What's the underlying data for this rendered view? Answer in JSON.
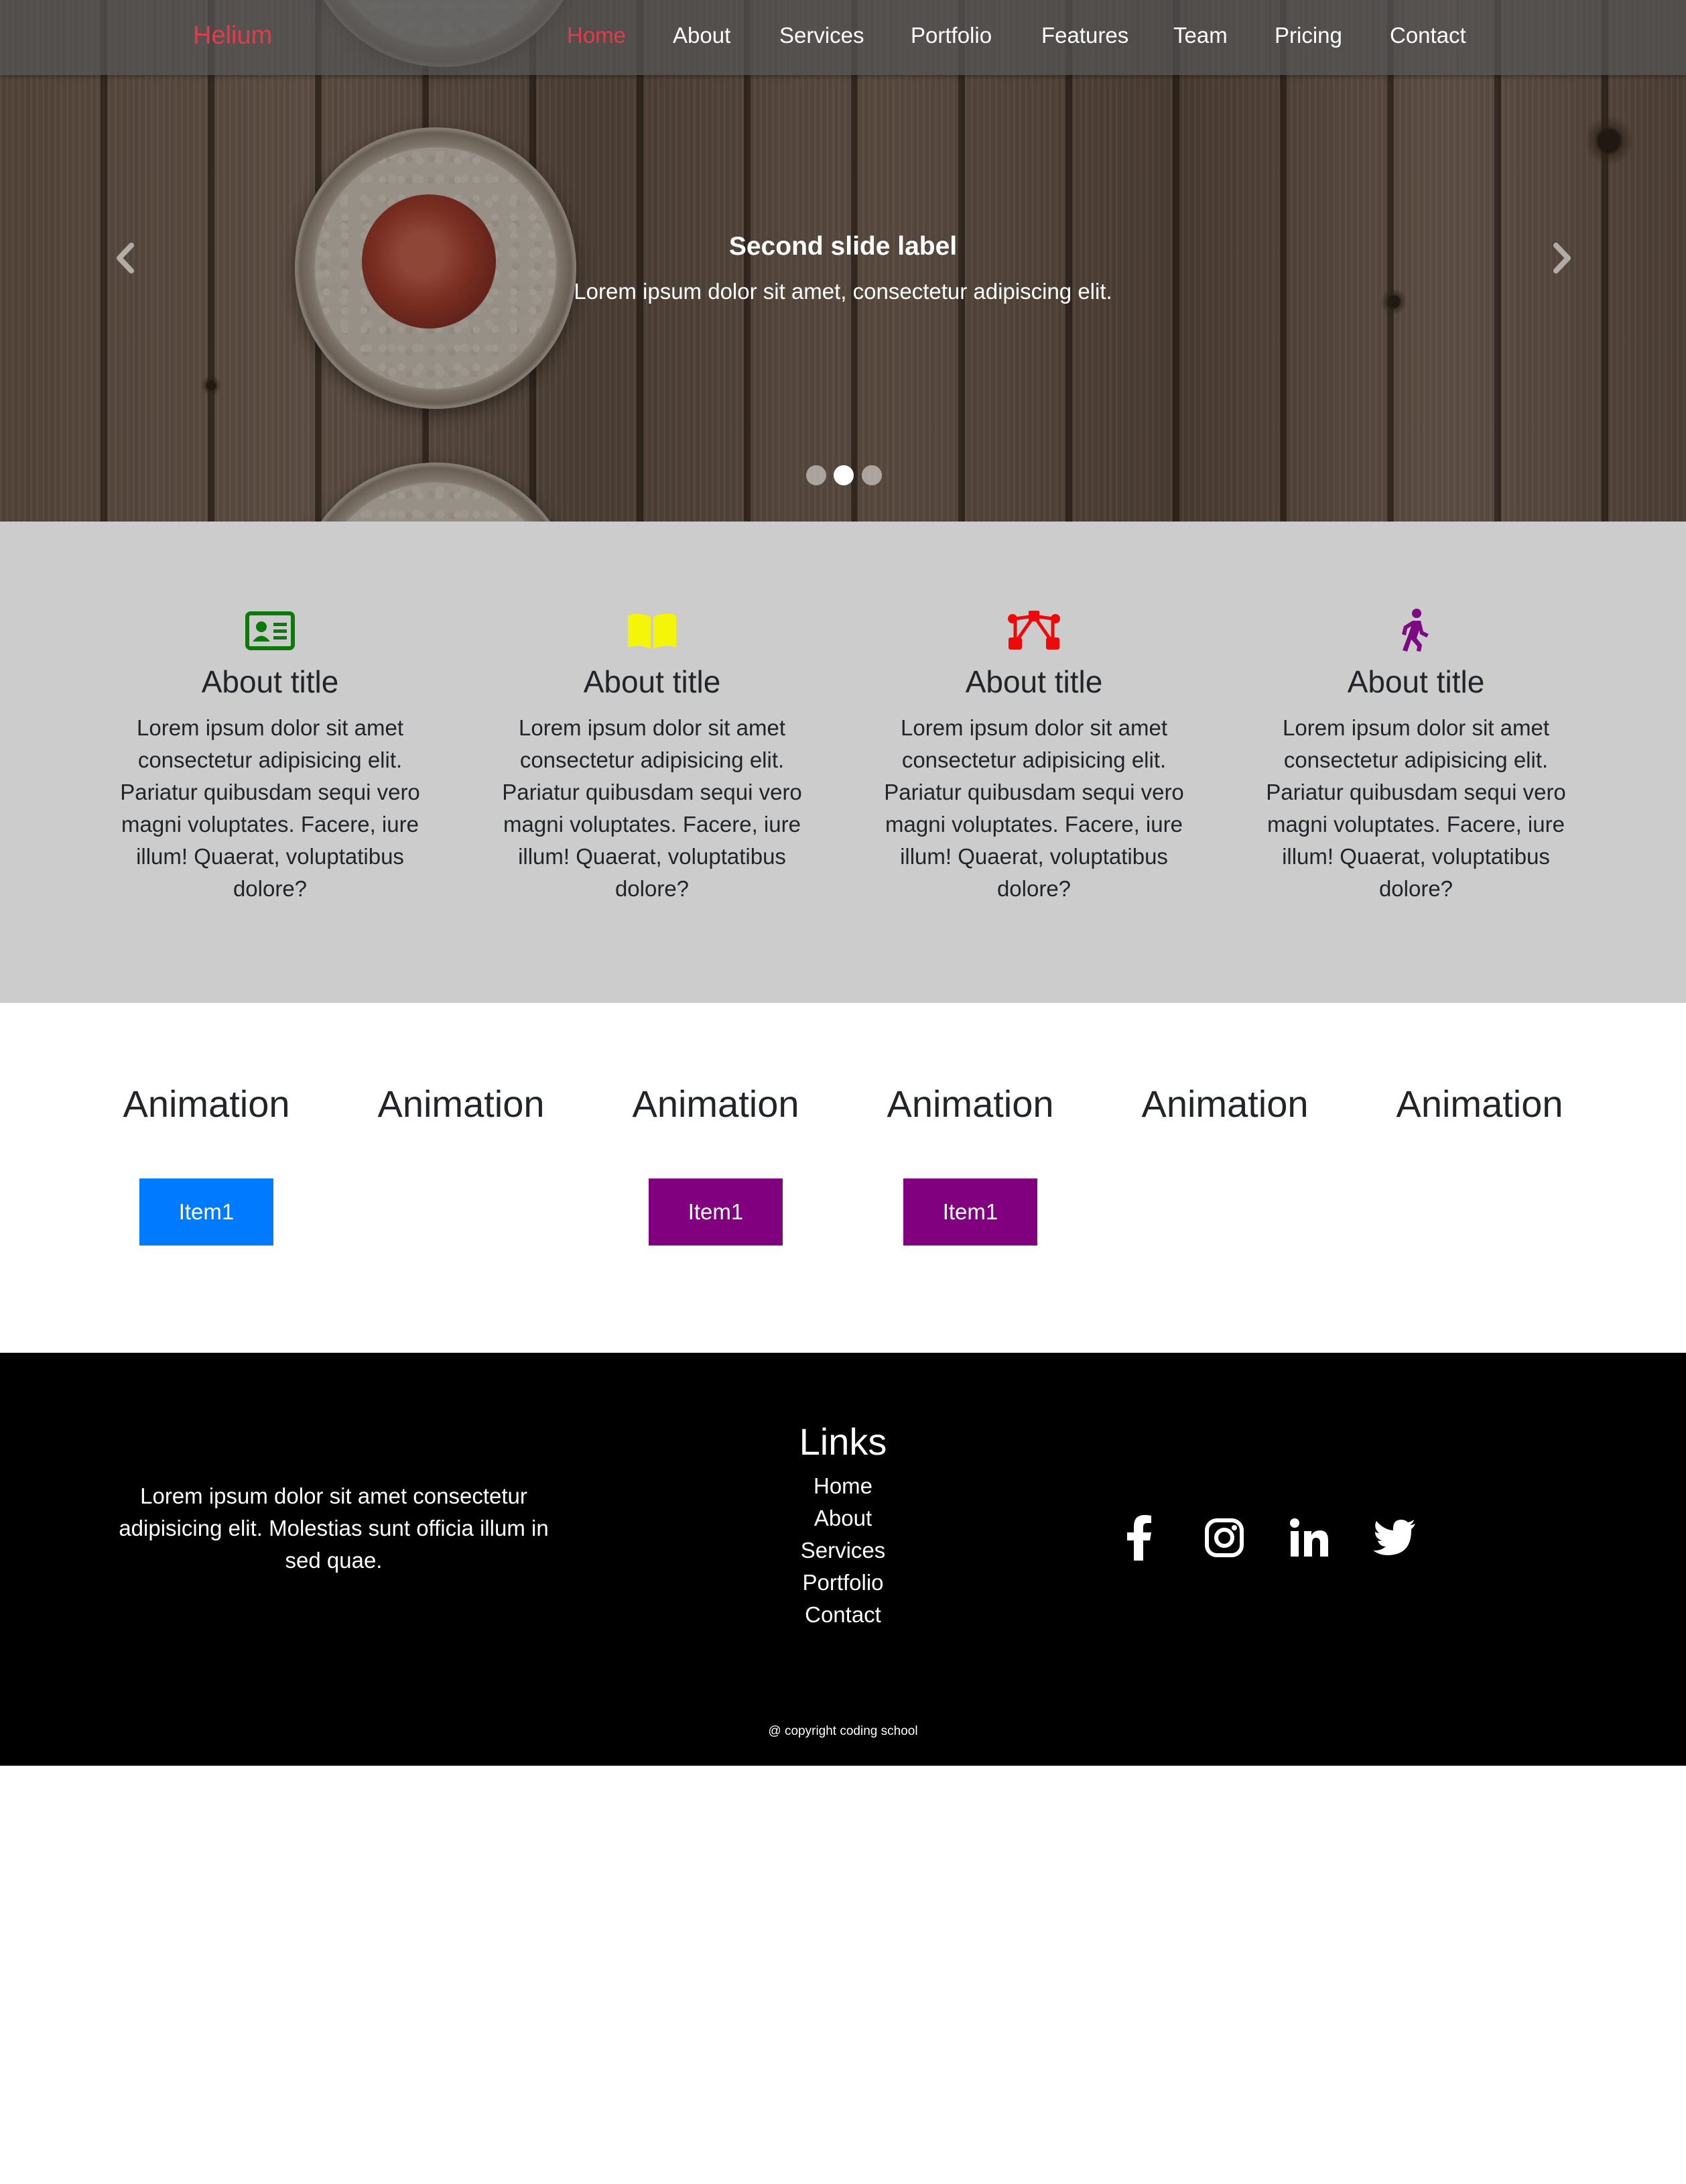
{
  "navbar": {
    "brand": "Helium",
    "items": [
      {
        "label": "Home",
        "active": true
      },
      {
        "label": "About"
      },
      {
        "label": "Services"
      },
      {
        "label": "Portfolio"
      },
      {
        "label": "Features"
      },
      {
        "label": "Team"
      },
      {
        "label": "Pricing"
      },
      {
        "label": "Contact"
      }
    ]
  },
  "carousel": {
    "caption_title": "Second slide label",
    "caption_text": "Lorem ipsum dolor sit amet, consectetur adipiscing elit.",
    "prev_icon": "chevron-left-icon",
    "next_icon": "chevron-right-icon",
    "slide_count": 3,
    "active_slide": 2
  },
  "about": {
    "cards": [
      {
        "icon": "id-card-icon",
        "icon_color": "#0b7a0b",
        "title": "About title",
        "text": "Lorem ipsum dolor sit amet consectetur adipisicing elit. Pariatur quibusdam sequi vero magni voluptates. Facere, iure illum! Quaerat, voluptatibus dolore?"
      },
      {
        "icon": "open-book-icon",
        "icon_color": "#f5f50a",
        "title": "About title",
        "text": "Lorem ipsum dolor sit amet consectetur adipisicing elit. Pariatur quibusdam sequi vero magni voluptates. Facere, iure illum! Quaerat, voluptatibus dolore?"
      },
      {
        "icon": "vector-nodes-icon",
        "icon_color": "#ee0a0a",
        "title": "About title",
        "text": "Lorem ipsum dolor sit amet consectetur adipisicing elit. Pariatur quibusdam sequi vero magni voluptates. Facere, iure illum! Quaerat, voluptatibus dolore?"
      },
      {
        "icon": "walking-person-icon",
        "icon_color": "#7c0a80",
        "title": "About title",
        "text": "Lorem ipsum dolor sit amet consectetur adipisicing elit. Pariatur quibusdam sequi vero magni voluptates. Facere, iure illum! Quaerat, voluptatibus dolore?"
      }
    ]
  },
  "animation": {
    "columns": [
      {
        "title": "Animation",
        "button": "Item1",
        "button_color": "#007bff"
      },
      {
        "title": "Animation"
      },
      {
        "title": "Animation",
        "button": "Item1",
        "button_color": "#800080"
      },
      {
        "title": "Animation",
        "button": "Item1",
        "button_color": "#800080"
      },
      {
        "title": "Animation"
      },
      {
        "title": "Animation"
      }
    ]
  },
  "footer": {
    "text": "Lorem ipsum dolor sit amet consectetur adipisicing elit. Molestias sunt officia illum in sed quae.",
    "links_title": "Links",
    "links": [
      "Home",
      "About",
      "Services",
      "Portfolio",
      "Contact"
    ],
    "social": [
      "facebook-icon",
      "instagram-icon",
      "linkedin-icon",
      "twitter-icon"
    ],
    "copyright": "@ copyright coding school"
  }
}
